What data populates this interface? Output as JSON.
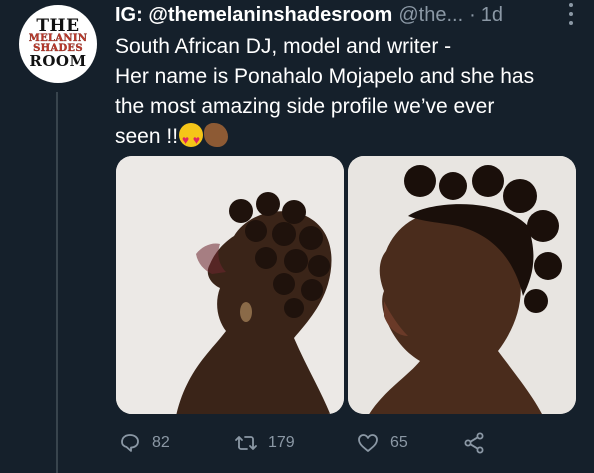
{
  "avatar": {
    "line1": "THE",
    "line2": "MELANIN",
    "line3": "SHADES",
    "line4": "ROOM",
    "colors": {
      "background": "#ffffff",
      "accent": "#c0392b"
    }
  },
  "tweet": {
    "display_name": "IG: @themelaninshadesroom",
    "handle": "@the...",
    "separator": "·",
    "time": "1d",
    "text_lines": [
      "South African DJ, model and writer -",
      "Her name is Ponahalo Mojapelo and she has",
      "the most amazing side profile we’ve ever",
      "seen !!"
    ],
    "emojis": [
      "smiling-face-with-heart-eyes",
      "clapping-hands"
    ],
    "media": [
      {
        "icon": "photo-side-profile-left",
        "background": "#ece9e6"
      },
      {
        "icon": "photo-side-profile-right",
        "background": "#e8e5e1"
      }
    ]
  },
  "actions": {
    "reply_count": "82",
    "retweet_count": "179",
    "like_count": "65"
  },
  "colors": {
    "background": "#15202b",
    "text": "#ffffff",
    "muted": "#8b98a5",
    "divider": "#38444d"
  }
}
